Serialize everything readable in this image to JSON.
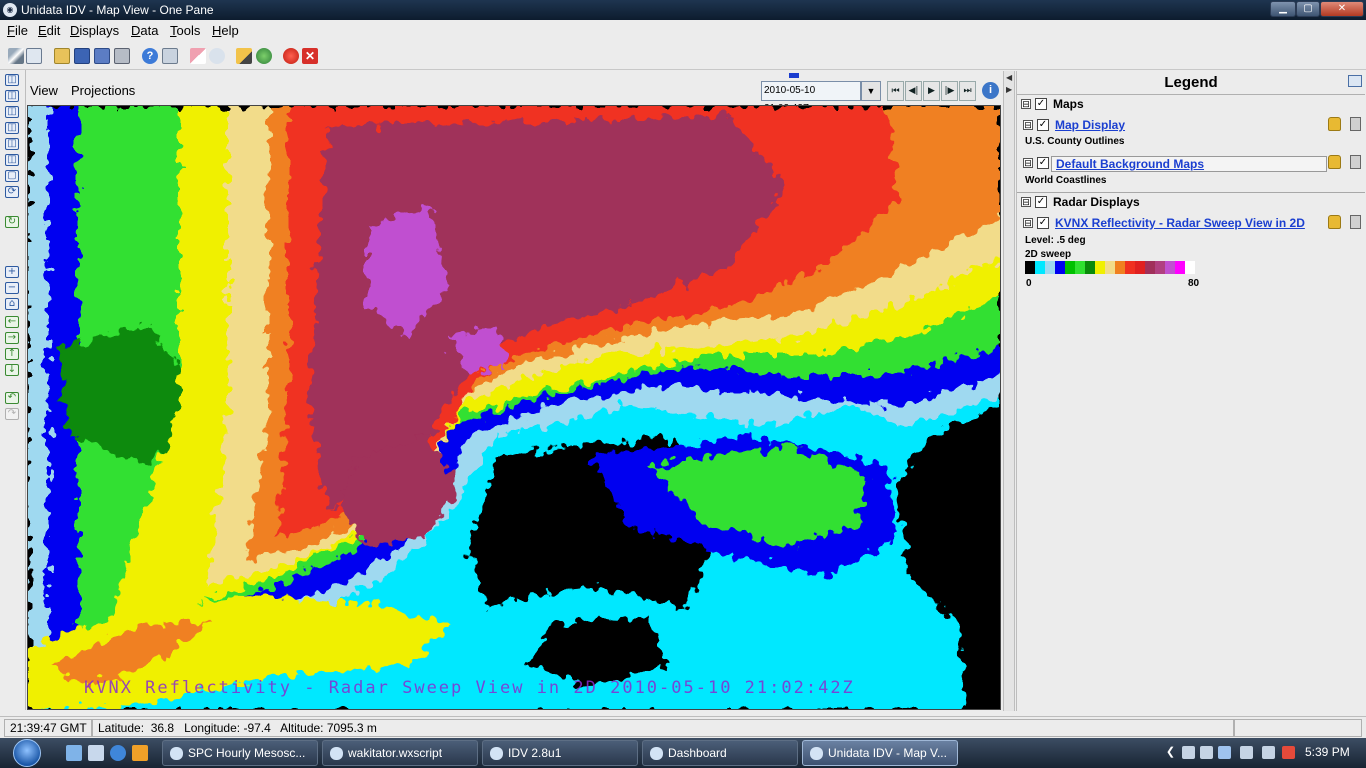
{
  "window": {
    "title": "Unidata IDV - Map View - One Pane",
    "icon": "idv-app-icon",
    "controls": [
      "minimize",
      "maximize",
      "close"
    ]
  },
  "menubar": {
    "items": [
      {
        "label": "File",
        "mnemonic": "F",
        "rest": "ile"
      },
      {
        "label": "Edit",
        "mnemonic": "E",
        "rest": "dit"
      },
      {
        "label": "Displays",
        "mnemonic": "D",
        "rest": "isplays"
      },
      {
        "label": "Data",
        "mnemonic": "D",
        "rest": "ata"
      },
      {
        "label": "Tools",
        "mnemonic": "T",
        "rest": "ools"
      },
      {
        "label": "Help",
        "mnemonic": "H",
        "rest": "elp"
      }
    ]
  },
  "toolbar": {
    "icons": [
      "wand-icon",
      "new-window-icon",
      "open-folder-icon",
      "save-icon",
      "save-as-icon",
      "capture-image-icon",
      "help-icon",
      "mail-icon",
      "eraser-icon",
      "scissors-icon",
      "pencil-icon",
      "globe-icon",
      "stop-icon",
      "close-icon"
    ],
    "help_glyph": "?",
    "close_glyph": "✕"
  },
  "view": {
    "menu": [
      "View",
      "Projections"
    ],
    "time_value": "2010-05-10 21:02:42Z",
    "dropdown_glyph": "▼",
    "animation_buttons": [
      "⏮",
      "◀|",
      "▶",
      "|▶",
      "⏭"
    ],
    "info_glyph": "i"
  },
  "map": {
    "overlay_text": "KVNX Reflectivity - Radar Sweep View in 2D 2010-05-10 21:02:42Z"
  },
  "legend": {
    "title": "Legend",
    "groups": [
      {
        "name": "Maps",
        "toggle": "⊟",
        "checked": "✓"
      },
      {
        "name": "Radar Displays",
        "toggle": "⊟",
        "checked": "✓"
      }
    ],
    "items": [
      {
        "name": "Map Display",
        "subtitle": "U.S. County Outlines"
      },
      {
        "name": "Default Background Maps",
        "subtitle": "World Coastlines"
      },
      {
        "name": "KVNX Reflectivity - Radar Sweep View in 2D",
        "subtitle_1": "Level: .5 deg",
        "subtitle_2": "2D sweep"
      }
    ],
    "colorbar": {
      "min": "0",
      "max": "80",
      "colors": [
        "#000000",
        "#00e8ff",
        "#9fd9f0",
        "#0000f0",
        "#00c000",
        "#30e030",
        "#0a8a0a",
        "#f0f000",
        "#f2dc8a",
        "#f08020",
        "#f03020",
        "#e02020",
        "#a0305a",
        "#b04080",
        "#c050d0",
        "#ff00ff",
        "#ffffff"
      ]
    }
  },
  "status": {
    "time": "21:39:47 GMT",
    "coords": "Latitude:  36.8   Longitude: -97.4   Altitude: 7095.3 m"
  },
  "taskbar": {
    "tasks": [
      {
        "label": "SPC Hourly Mesosc...",
        "active": false
      },
      {
        "label": "wakitator.wxscript",
        "active": false
      },
      {
        "label": "IDV 2.8u1",
        "active": false
      },
      {
        "label": "Dashboard",
        "active": false
      },
      {
        "label": "Unidata IDV - Map V...",
        "active": true
      }
    ],
    "clock": "5:39 PM"
  }
}
